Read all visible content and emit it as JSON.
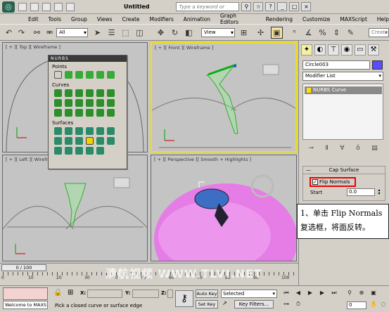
{
  "titlebar": {
    "title": "Untitled",
    "search_placeholder": "Type a keyword or phrase"
  },
  "menu": [
    "Edit",
    "Tools",
    "Group",
    "Views",
    "Create",
    "Modifiers",
    "Animation",
    "Graph Editors",
    "Rendering",
    "Customize",
    "MAXScript",
    "Help"
  ],
  "toolbar": {
    "filter_value": "All",
    "refcoord_value": "View",
    "selection_set_placeholder": "Create"
  },
  "viewports": {
    "top_label": "[ + ][ Top ][ Wireframe ]",
    "front_label": "[ + ][ Front ][ Wireframe ]",
    "left_label": "[ + ][ Left ][ Wireframe ]",
    "perspective_label": "[ + ][ Perspective ][ Smooth + Highlights ]"
  },
  "nurbs_panel": {
    "title": "NURBS",
    "points_label": "Points",
    "curves_label": "Curves",
    "surfaces_label": "Surfaces"
  },
  "command_panel": {
    "object_name": "Circle003",
    "object_color": "#5a4bff",
    "modifier_list": "Modifier List",
    "stack_item": "NURBS Curve",
    "rollout_title": "Cap Surface",
    "flip_normals_label": "Flip Normals",
    "flip_normals_checked": true,
    "start_label": "Start",
    "start_value": "0.0"
  },
  "annotation": {
    "line1": "1、单击 Flip Normals",
    "line2": "复选框，将面反转。"
  },
  "timeline": {
    "frame_display": "0 / 100",
    "ticks": [
      "0",
      "10",
      "20",
      "30",
      "40",
      "50",
      "60",
      "70",
      "80",
      "90",
      "100"
    ],
    "watermark": "清航视频 WWW.TLVI.NET"
  },
  "status": {
    "welcome": "Welcome to MAXS",
    "prompt": "Pick a closed curve or surface edge",
    "x_label": "X:",
    "y_label": "Y:",
    "z_label": "Z:",
    "auto_key": "Auto Key",
    "set_key": "Set Key",
    "selected_value": "Selected",
    "key_filters": "Key Filters...",
    "current_frame": "0"
  }
}
